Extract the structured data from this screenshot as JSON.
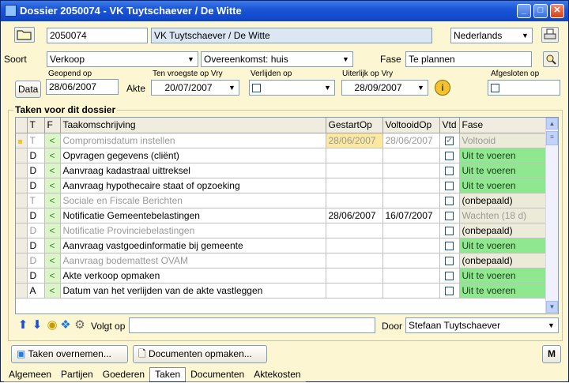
{
  "window": {
    "title": "Dossier 2050074 - VK Tuytschaever / De Witte",
    "buttons": {
      "minimize": "_",
      "maximize": "□",
      "close": "✕"
    }
  },
  "header": {
    "dossier_nr": "2050074",
    "dossier_name": "VK Tuytschaever / De Witte",
    "language": "Nederlands"
  },
  "soort": {
    "label": "Soort",
    "value": "Verkoop",
    "subtype": "Overeenkomst: huis",
    "fase_label": "Fase",
    "fase_value": "Te plannen"
  },
  "dates": {
    "data_button": "Data",
    "geopend_label": "Geopend op",
    "geopend_value": "28/06/2007",
    "akte_label": "Akte",
    "vroegste_label": "Ten vroegste op Vry",
    "vroegste_value": "20/07/2007",
    "verlijden_label": "Verlijden op",
    "uiterlijk_label": "Uiterlijk op Vry",
    "uiterlijk_value": "28/09/2007",
    "afgesloten_label": "Afgesloten op"
  },
  "tasks": {
    "group_title": "Taken voor dit dossier",
    "columns": [
      "T",
      "F",
      "Taakomschrijving",
      "GestartOp",
      "VoltooidOp",
      "Vtd",
      "Fase"
    ],
    "rows": [
      {
        "t": "T",
        "f": "<",
        "desc": "Compromisdatum instellen",
        "started": "28/06/2007",
        "done": "28/06/2007",
        "vtd": "✔",
        "fase": "Voltooid",
        "style": "gray",
        "fase_style": "beige-gray",
        "marker": true
      },
      {
        "t": "D",
        "f": "<",
        "desc": "Opvragen gegevens (cliënt)",
        "started": "",
        "done": "",
        "vtd": "",
        "fase": "Uit te voeren",
        "style": "",
        "fase_style": "green"
      },
      {
        "t": "D",
        "f": "<",
        "desc": "Aanvraag kadastraal uittreksel",
        "started": "",
        "done": "",
        "vtd": "",
        "fase": "Uit te voeren",
        "style": "",
        "fase_style": "green"
      },
      {
        "t": "D",
        "f": "<",
        "desc": "Aanvraag hypothecaire staat of opzoeking",
        "started": "",
        "done": "",
        "vtd": "",
        "fase": "Uit te voeren",
        "style": "",
        "fase_style": "green"
      },
      {
        "t": "T",
        "f": "<",
        "desc": "Sociale en Fiscale Berichten",
        "started": "",
        "done": "",
        "vtd": "",
        "fase": "(onbepaald)",
        "style": "gray",
        "fase_style": "beige"
      },
      {
        "t": "D",
        "f": "<",
        "desc": "Notificatie Gemeentebelastingen",
        "started": "28/06/2007",
        "done": "16/07/2007",
        "vtd": "",
        "fase": "Wachten (18 d)",
        "style": "",
        "fase_style": "beige-gray"
      },
      {
        "t": "D",
        "f": "<",
        "desc": "Notificatie Provinciebelastingen",
        "started": "",
        "done": "",
        "vtd": "",
        "fase": "(onbepaald)",
        "style": "gray",
        "fase_style": "beige"
      },
      {
        "t": "D",
        "f": "<",
        "desc": "Aanvraag vastgoedinformatie bij gemeente",
        "started": "",
        "done": "",
        "vtd": "",
        "fase": "Uit te voeren",
        "style": "",
        "fase_style": "green"
      },
      {
        "t": "D",
        "f": "<",
        "desc": "Aanvraag bodemattest OVAM",
        "started": "",
        "done": "",
        "vtd": "",
        "fase": "(onbepaald)",
        "style": "gray",
        "fase_style": "beige"
      },
      {
        "t": "D",
        "f": "<",
        "desc": "Akte verkoop opmaken",
        "started": "",
        "done": "",
        "vtd": "",
        "fase": "Uit te voeren",
        "style": "",
        "fase_style": "green"
      },
      {
        "t": "A",
        "f": "<",
        "desc": "Datum van het verlijden van de akte vastleggen",
        "started": "",
        "done": "",
        "vtd": "",
        "fase": "Uit te voeren",
        "style": "",
        "fase_style": "green"
      }
    ]
  },
  "bottom": {
    "volgt_op_label": "Volgt op",
    "volgt_op_value": "",
    "door_label": "Door",
    "door_value": "Stefaan Tuytschaever",
    "taken_overnemen": "Taken overnemen...",
    "documenten_opmaken": "Documenten opmaken...",
    "m_button": "M"
  },
  "tabs": [
    "Algemeen",
    "Partijen",
    "Goederen",
    "Taken",
    "Documenten",
    "Aktekosten"
  ],
  "active_tab": "Taken",
  "colors": {
    "background": "#fdf6d2",
    "title_blue": "#1a56d6",
    "fase_green": "#8fe88f"
  }
}
